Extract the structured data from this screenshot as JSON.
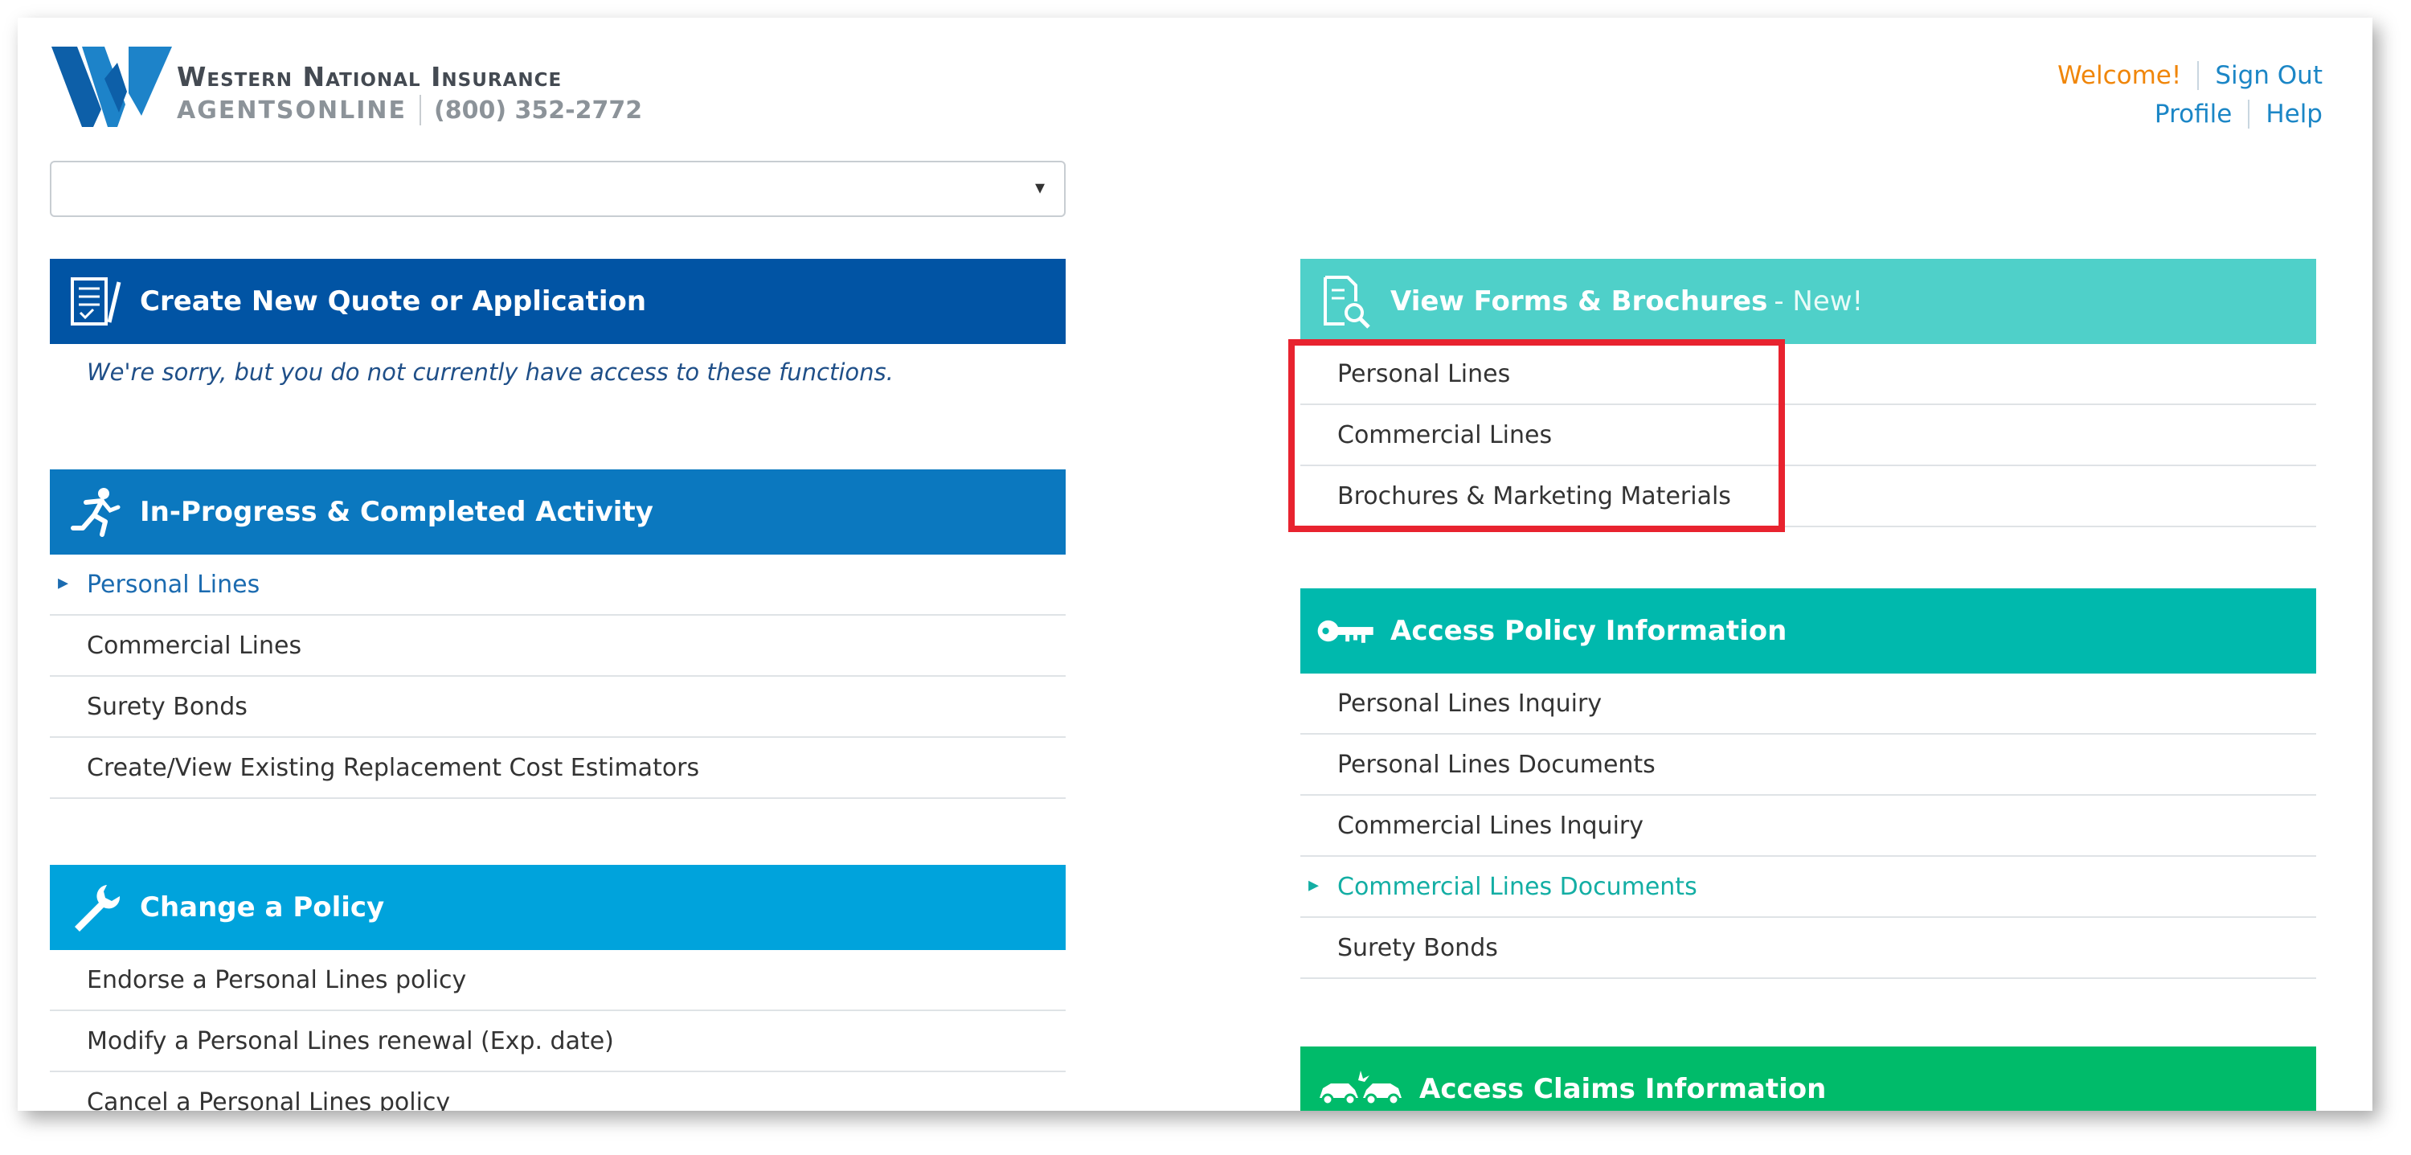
{
  "header": {
    "brand_name": "Western National Insurance",
    "brand_sub": "AGENTSONLINE",
    "phone": "(800) 352-2772",
    "welcome": "Welcome!",
    "sign_out": "Sign Out",
    "profile": "Profile",
    "help": "Help",
    "logo_icon": "wn-logo-icon"
  },
  "select": {
    "value": "",
    "caret": "▾"
  },
  "colors": {
    "create_quote": "#0154a4",
    "in_progress": "#0b78bf",
    "change_policy": "#00a3dc",
    "view_forms": "#4fd0c9",
    "access_policy": "#00b9ad",
    "claims": "#00bb6a",
    "welcome": "#f0860a",
    "link": "#1b86c6",
    "highlight": "#e8232f"
  },
  "panels": {
    "create_quote": {
      "title": "Create New Quote or Application",
      "icon": "document-check-icon",
      "note": "We're sorry, but you do not currently have access to these functions."
    },
    "in_progress": {
      "title": "In-Progress & Completed Activity",
      "icon": "running-person-icon",
      "items": [
        {
          "label": "Personal Lines",
          "active": true
        },
        {
          "label": "Commercial Lines"
        },
        {
          "label": "Surety Bonds"
        },
        {
          "label": "Create/View Existing Replacement Cost Estimators"
        }
      ]
    },
    "change_policy": {
      "title": "Change a Policy",
      "icon": "wrench-icon",
      "items": [
        {
          "label": "Endorse a Personal Lines policy"
        },
        {
          "label": "Modify a Personal Lines renewal (Exp. date)"
        },
        {
          "label": "Cancel a Personal Lines policy"
        }
      ]
    },
    "view_forms": {
      "title": "View Forms & Brochures",
      "suffix": "- New!",
      "icon": "document-search-icon",
      "items": [
        {
          "label": "Personal Lines"
        },
        {
          "label": "Commercial Lines"
        },
        {
          "label": "Brochures & Marketing Materials"
        }
      ]
    },
    "access_policy": {
      "title": "Access Policy Information",
      "icon": "key-icon",
      "items": [
        {
          "label": "Personal Lines Inquiry"
        },
        {
          "label": "Personal Lines Documents"
        },
        {
          "label": "Commercial Lines Inquiry"
        },
        {
          "label": "Commercial Lines Documents",
          "active": true
        },
        {
          "label": "Surety Bonds"
        }
      ]
    },
    "claims": {
      "title": "Access Claims Information",
      "icon": "car-crash-icon"
    }
  }
}
